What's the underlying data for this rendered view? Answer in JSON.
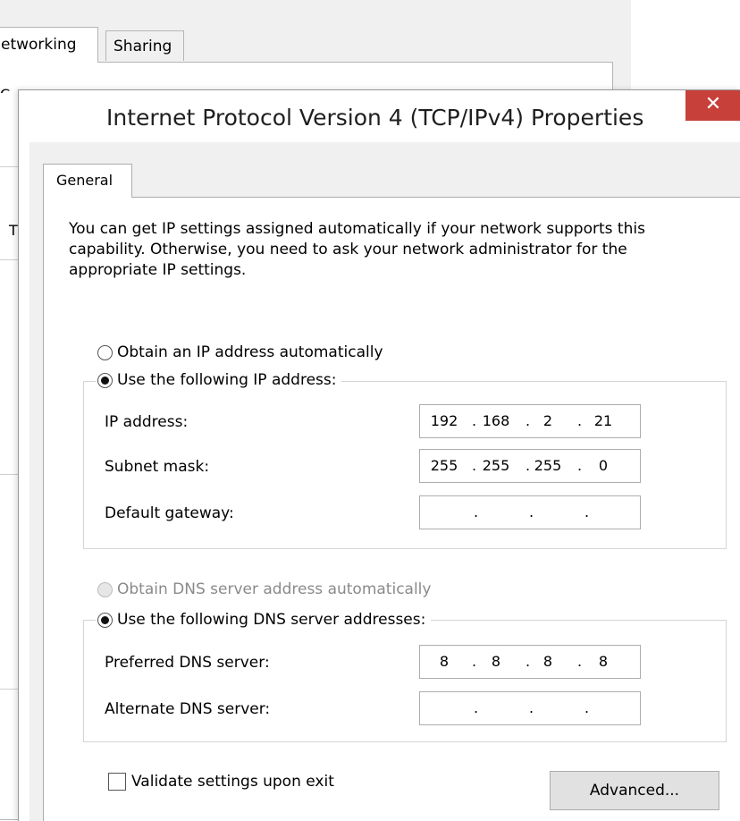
{
  "background_window": {
    "tabs": [
      "etworking",
      "Sharing"
    ],
    "connect_text_fragment": "Connect using",
    "fragment_t": "T"
  },
  "dialog": {
    "title": "Internet Protocol Version 4 (TCP/IPv4) Properties",
    "close_glyph": "✕",
    "tab_label": "General",
    "intro": "You can get IP settings assigned automatically if your network supports this capability. Otherwise, you need to ask your network administrator for the appropriate IP settings.",
    "ip": {
      "obtain_auto_label": "Obtain an IP address automatically",
      "use_following_label": "Use the following IP address:",
      "fields": [
        {
          "label": "IP address:",
          "segments": [
            "192",
            "168",
            "2",
            "21"
          ]
        },
        {
          "label": "Subnet mask:",
          "segments": [
            "255",
            "255",
            "255",
            "0"
          ]
        },
        {
          "label": "Default gateway:",
          "segments": [
            "",
            "",
            "",
            ""
          ]
        }
      ]
    },
    "dns": {
      "obtain_auto_label": "Obtain DNS server address automatically",
      "use_following_label": "Use the following DNS server addresses:",
      "fields": [
        {
          "label": "Preferred DNS server:",
          "segments": [
            "8",
            "8",
            "8",
            "8"
          ]
        },
        {
          "label": "Alternate DNS server:",
          "segments": [
            "",
            "",
            "",
            ""
          ]
        }
      ]
    },
    "validate_label": "Validate settings upon exit",
    "advanced_label": "Advanced..."
  },
  "colors": {
    "close_button": "#c7403a",
    "dialog_background": "#f0f0f0"
  }
}
